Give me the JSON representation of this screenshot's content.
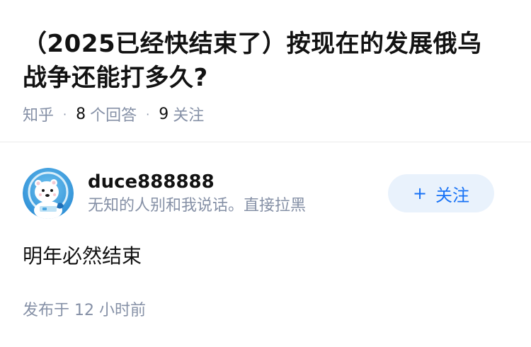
{
  "question": {
    "title": "（2025已经快结束了）按现在的发展俄乌战争还能打多久?",
    "source": "知乎",
    "answer_count": "8",
    "answer_label": "个回答",
    "follower_count": "9",
    "follower_label": "关注",
    "separator": "·"
  },
  "answer": {
    "author": {
      "name": "duce888888",
      "bio": "无知的人别和我说话。直接拉黑",
      "avatar_icon": "polar-bear-astronaut-avatar"
    },
    "follow_button": {
      "plus": "+",
      "label": "关注"
    },
    "content": "明年必然结束",
    "time": "发布于 12 小时前"
  },
  "colors": {
    "title": "#121212",
    "meta": "#8590a6",
    "follow_bg": "#e9f2fc",
    "follow_text": "#1772f6",
    "divider": "#ebebeb"
  }
}
